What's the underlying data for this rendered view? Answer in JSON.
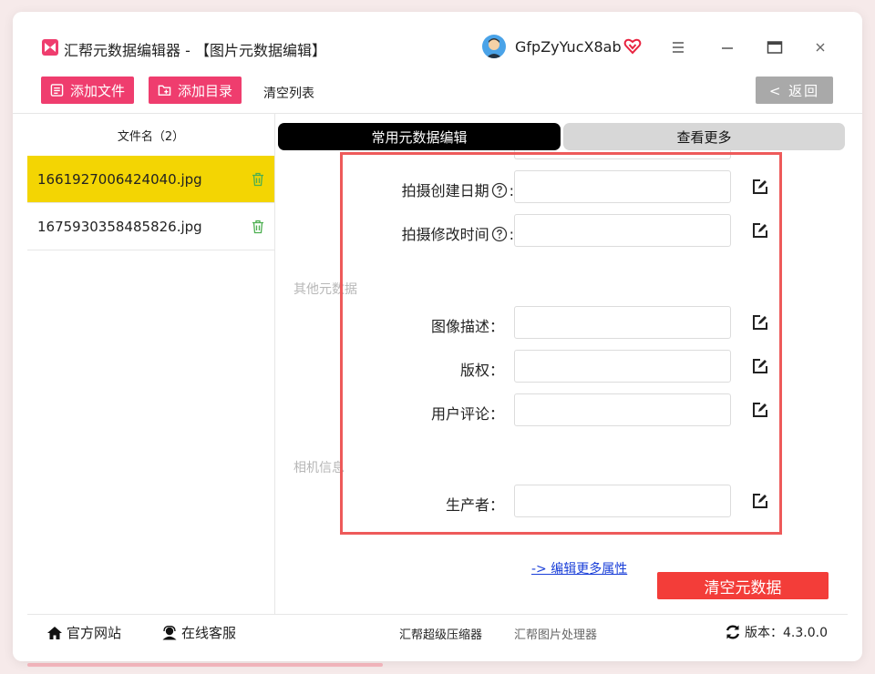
{
  "titlebar": {
    "app_title": "汇帮元数据编辑器 - 【图片元数据编辑】",
    "username": "GfpZyYucX8ab"
  },
  "toolbar": {
    "add_file": "添加文件",
    "add_dir": "添加目录",
    "clear_list": "清空列表",
    "back": "< 返回"
  },
  "file_list": {
    "header": "文件名（2）",
    "files": [
      {
        "name": "1661927006424040.jpg"
      },
      {
        "name": "1675930358485826.jpg"
      }
    ]
  },
  "tabs": {
    "common": "常用元数据编辑",
    "more": "查看更多"
  },
  "form": {
    "shoot_create_date": {
      "label": "拍摄创建日期",
      "value": ""
    },
    "shoot_modify_time": {
      "label": "拍摄修改时间",
      "value": ""
    },
    "other_section": "其他元数据",
    "image_desc": {
      "label": "图像描述：",
      "value": ""
    },
    "copyright": {
      "label": "版权：",
      "value": ""
    },
    "user_comment": {
      "label": "用户评论：",
      "value": ""
    },
    "camera_section": "相机信息",
    "producer": {
      "label": "生产者：",
      "value": ""
    }
  },
  "actions": {
    "edit_more": "-> 编辑更多属性",
    "clear_metadata": "清空元数据"
  },
  "footer": {
    "website": "官方网站",
    "support": "在线客服",
    "compressor": "汇帮超级压缩器",
    "image_processor": "汇帮图片处理器",
    "version": "版本：4.3.0.0"
  },
  "colors": {
    "accent_pink": "#ef3d6e",
    "selected_row": "#f3d503",
    "clear_button": "#f33d39",
    "highlight_border": "#ee5a5a"
  }
}
